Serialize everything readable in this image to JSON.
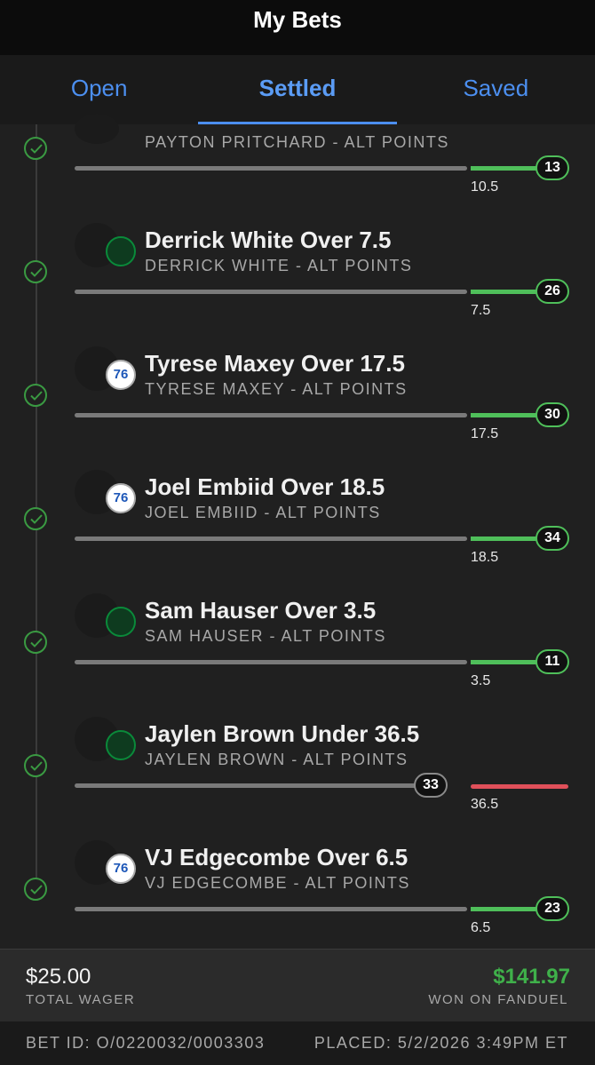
{
  "header": {
    "title": "My Bets"
  },
  "tabs": [
    {
      "label": "Open"
    },
    {
      "label": "Settled"
    },
    {
      "label": "Saved"
    }
  ],
  "legs": [
    {
      "title": "",
      "subtitle": "PAYTON PRITCHARD - ALT POINTS",
      "team": "celtics",
      "line": "10.5",
      "result": "13",
      "outcome": "over",
      "status": "won"
    },
    {
      "title": "Derrick White Over 7.5",
      "subtitle": "DERRICK WHITE - ALT POINTS",
      "team": "celtics",
      "line": "7.5",
      "result": "26",
      "outcome": "over",
      "status": "won"
    },
    {
      "title": "Tyrese Maxey Over 17.5",
      "subtitle": "TYRESE MAXEY - ALT POINTS",
      "team": "76ers",
      "team_text": "76",
      "line": "17.5",
      "result": "30",
      "outcome": "over",
      "status": "won"
    },
    {
      "title": "Joel Embiid Over 18.5",
      "subtitle": "JOEL EMBIID - ALT POINTS",
      "team": "76ers",
      "team_text": "76",
      "line": "18.5",
      "result": "34",
      "outcome": "over",
      "status": "won"
    },
    {
      "title": "Sam Hauser Over 3.5",
      "subtitle": "SAM HAUSER - ALT POINTS",
      "team": "celtics",
      "line": "3.5",
      "result": "11",
      "outcome": "over",
      "status": "won"
    },
    {
      "title": "Jaylen Brown Under 36.5",
      "subtitle": "JAYLEN BROWN - ALT POINTS",
      "team": "celtics",
      "line": "36.5",
      "result": "33",
      "outcome": "under",
      "status": "won"
    },
    {
      "title": "VJ Edgecombe Over 6.5",
      "subtitle": "VJ EDGECOMBE - ALT POINTS",
      "team": "76ers",
      "team_text": "76",
      "line": "6.5",
      "result": "23",
      "outcome": "over",
      "status": "won"
    }
  ],
  "footer": {
    "wager": "$25.00",
    "wager_label": "TOTAL WAGER",
    "won": "$141.97",
    "won_label": "WON ON FANDUEL"
  },
  "bottom": {
    "bet_id": "BET ID: O/0220032/0003303",
    "placed": "PLACED: 5/2/2026 3:49PM ET"
  },
  "colors": {
    "accent": "#4c8ff0",
    "win_green": "#4fbf5a",
    "loss_red": "#e0505a",
    "won_amount": "#3fb04a",
    "celtics_green": "#0a8a3a",
    "sixers_blue": "#1d57b8",
    "sixers_red": "#d8262f"
  },
  "icons": {
    "status": "check-circle-icon",
    "celtics": "celtics-logo",
    "76ers": "sixers-logo"
  }
}
